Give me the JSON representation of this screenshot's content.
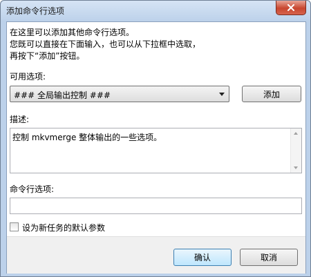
{
  "window": {
    "title": "添加命令行选项"
  },
  "intro": {
    "line1": "在这里可以添加其他命令行选项。",
    "line2": "您既可以直接在下面输入，也可以从下拉框中选取，",
    "line3": "再按下“添加”按钮。"
  },
  "available": {
    "label": "可用选项:",
    "selected": "### 全局输出控制 ###",
    "add_label": "添加"
  },
  "description": {
    "label": "描述:",
    "text": "控制 mkvmerge 整体输出的一些选项。"
  },
  "cmdline": {
    "label": "命令行选项:",
    "value": ""
  },
  "default_checkbox": {
    "label": "设为新任务的默认参数",
    "checked": false
  },
  "buttons": {
    "ok_label": "确认",
    "cancel_label": "取消"
  }
}
